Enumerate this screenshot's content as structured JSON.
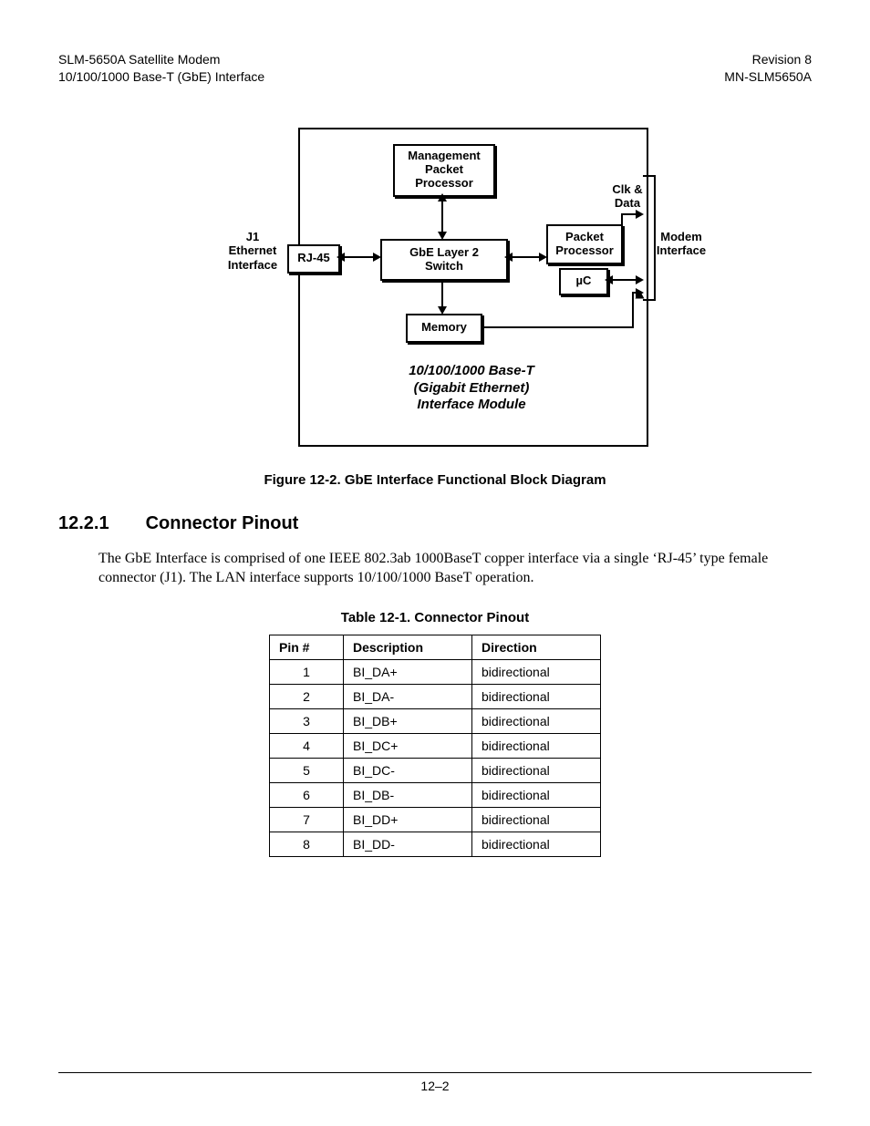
{
  "header": {
    "left_line1": "SLM-5650A Satellite Modem",
    "left_line2": "10/100/1000 Base-T (GbE) Interface",
    "right_line1": "Revision 8",
    "right_line2": "MN-SLM5650A"
  },
  "diagram": {
    "j1_label": "J1\nEthernet\nInterface",
    "rj45": "RJ-45",
    "mgmt": "Management\nPacket\nProcessor",
    "switch": "GbE Layer 2\nSwitch",
    "memory": "Memory",
    "packet_processor": "Packet\nProcessor",
    "uc": "µC",
    "clk_data": "Clk &\nData",
    "modem_if": "Modem\nInterface",
    "module_title": "10/100/1000 Base-T\n(Gigabit Ethernet)\nInterface Module"
  },
  "figure_caption": "Figure 12-2. GbE Interface Functional Block Diagram",
  "section": {
    "number": "12.2.1",
    "title": "Connector Pinout"
  },
  "paragraph": "The GbE Interface is comprised of one IEEE 802.3ab 1000BaseT copper interface via a single ‘RJ-45’ type female connector (J1). The LAN interface supports 10/100/1000 BaseT operation.",
  "table_caption": "Table 12-1. Connector Pinout",
  "table": {
    "headers": {
      "pin": "Pin #",
      "description": "Description",
      "direction": "Direction"
    },
    "rows": [
      {
        "pin": "1",
        "description": "BI_DA+",
        "direction": "bidirectional"
      },
      {
        "pin": "2",
        "description": "BI_DA-",
        "direction": "bidirectional"
      },
      {
        "pin": "3",
        "description": "BI_DB+",
        "direction": "bidirectional"
      },
      {
        "pin": "4",
        "description": "BI_DC+",
        "direction": "bidirectional"
      },
      {
        "pin": "5",
        "description": "BI_DC-",
        "direction": "bidirectional"
      },
      {
        "pin": "6",
        "description": "BI_DB-",
        "direction": "bidirectional"
      },
      {
        "pin": "7",
        "description": "BI_DD+",
        "direction": "bidirectional"
      },
      {
        "pin": "8",
        "description": "BI_DD-",
        "direction": "bidirectional"
      }
    ]
  },
  "footer": {
    "page_number": "12–2"
  }
}
